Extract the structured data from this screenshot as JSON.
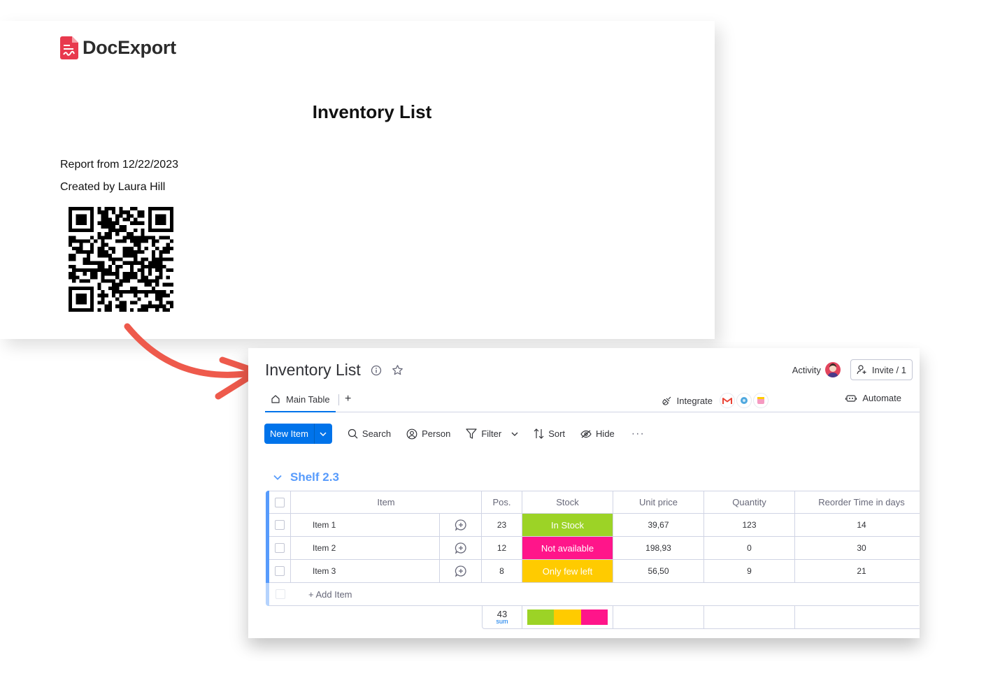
{
  "doc": {
    "brand": "DocExport",
    "title": "Inventory List",
    "report_line": "Report from 12/22/2023",
    "created_line": "Created by Laura Hill"
  },
  "board": {
    "title": "Inventory List",
    "activity_label": "Activity",
    "invite_label": "Invite / 1",
    "tab_main": "Main Table",
    "tab_add": "+",
    "integrate_label": "Integrate",
    "automate_label": "Automate"
  },
  "toolbar": {
    "new_item": "New Item",
    "search": "Search",
    "person": "Person",
    "filter": "Filter",
    "sort": "Sort",
    "hide": "Hide",
    "more": "···"
  },
  "group": {
    "name": "Shelf 2.3",
    "columns": [
      "Item",
      "Pos.",
      "Stock",
      "Unit price",
      "Quantity",
      "Reorder Time in days"
    ],
    "rows": [
      {
        "item": "Item 1",
        "pos": "23",
        "stock": "In Stock",
        "stock_color": "#9cd326",
        "unit_price": "39,67",
        "quantity": "123",
        "reorder": "14"
      },
      {
        "item": "Item 2",
        "pos": "12",
        "stock": "Not available",
        "stock_color": "#ff158a",
        "unit_price": "198,93",
        "quantity": "0",
        "reorder": "30"
      },
      {
        "item": "Item 3",
        "pos": "8",
        "stock": "Only few left",
        "stock_color": "#ffcb00",
        "unit_price": "56,50",
        "quantity": "9",
        "reorder": "21"
      }
    ],
    "add_item": "+ Add Item",
    "summary": {
      "pos_sum": "43",
      "pos_sum_label": "sum",
      "stock_colors": [
        "#9cd326",
        "#ffcb00",
        "#ff158a"
      ]
    }
  },
  "colors": {
    "accent": "#0073ea",
    "group": "#579bfc",
    "brand_red": "#e8394d",
    "arrow": "#ee5a4c"
  }
}
